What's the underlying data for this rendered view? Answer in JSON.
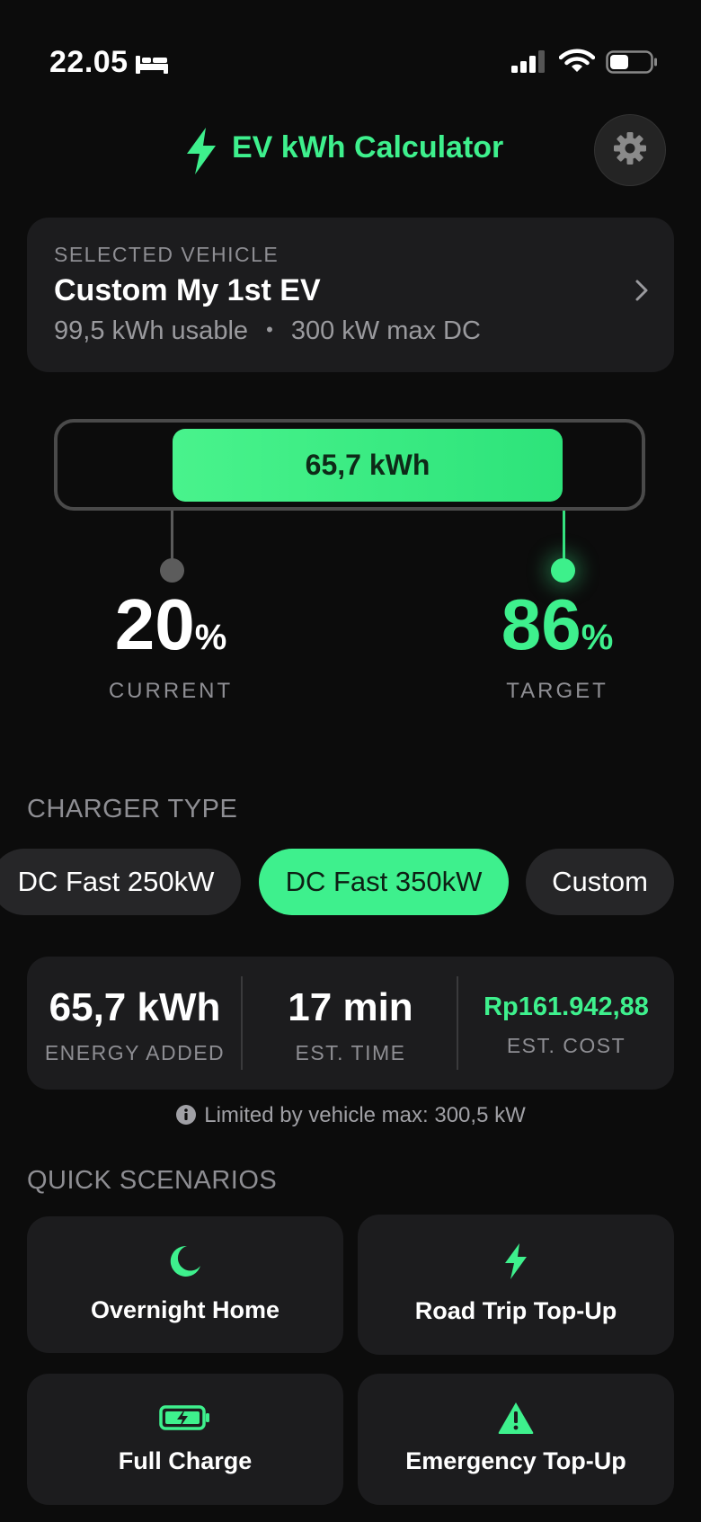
{
  "status_bar": {
    "time": "22.05",
    "icons": [
      "bed-icon",
      "cellular-signal-icon",
      "wifi-icon",
      "battery-icon"
    ]
  },
  "header": {
    "title": "EV kWh Calculator",
    "logo_icon": "lightning-bolt-icon",
    "settings_icon": "gear-icon"
  },
  "vehicle": {
    "section_label": "SELECTED VEHICLE",
    "name": "Custom My 1st EV",
    "usable": "99,5 kWh usable",
    "separator": "•",
    "max_dc": "300 kW max DC",
    "chevron_icon": "chevron-right-icon"
  },
  "battery": {
    "energy_label": "65,7 kWh",
    "current_percent": "20",
    "target_percent": "86",
    "percent_sign": "%",
    "current_label": "CURRENT",
    "target_label": "TARGET"
  },
  "charger": {
    "heading": "CHARGER TYPE",
    "options": [
      "DC Fast 250kW",
      "DC Fast 350kW",
      "Custom"
    ],
    "selected": "DC Fast 350kW"
  },
  "results": {
    "energy_value": "65,7 kWh",
    "energy_label": "ENERGY ADDED",
    "time_value": "17 min",
    "time_label": "EST. TIME",
    "cost_value": "Rp161.942,88",
    "cost_label": "EST. COST",
    "note": "Limited by vehicle max: 300,5 kW",
    "note_icon": "info-icon"
  },
  "scenarios": {
    "heading": "QUICK SCENARIOS",
    "items": [
      {
        "label": "Overnight Home",
        "icon": "moon-icon"
      },
      {
        "label": "Road Trip Top-Up",
        "icon": "lightning-bolt-icon"
      },
      {
        "label": "Full Charge",
        "icon": "battery-charging-icon"
      },
      {
        "label": "Emergency Top-Up",
        "icon": "warning-triangle-icon"
      }
    ]
  },
  "colors": {
    "accent": "#3ef08d",
    "background": "#0c0c0c",
    "card": "#1c1c1e",
    "muted_text": "#8e8e93"
  }
}
